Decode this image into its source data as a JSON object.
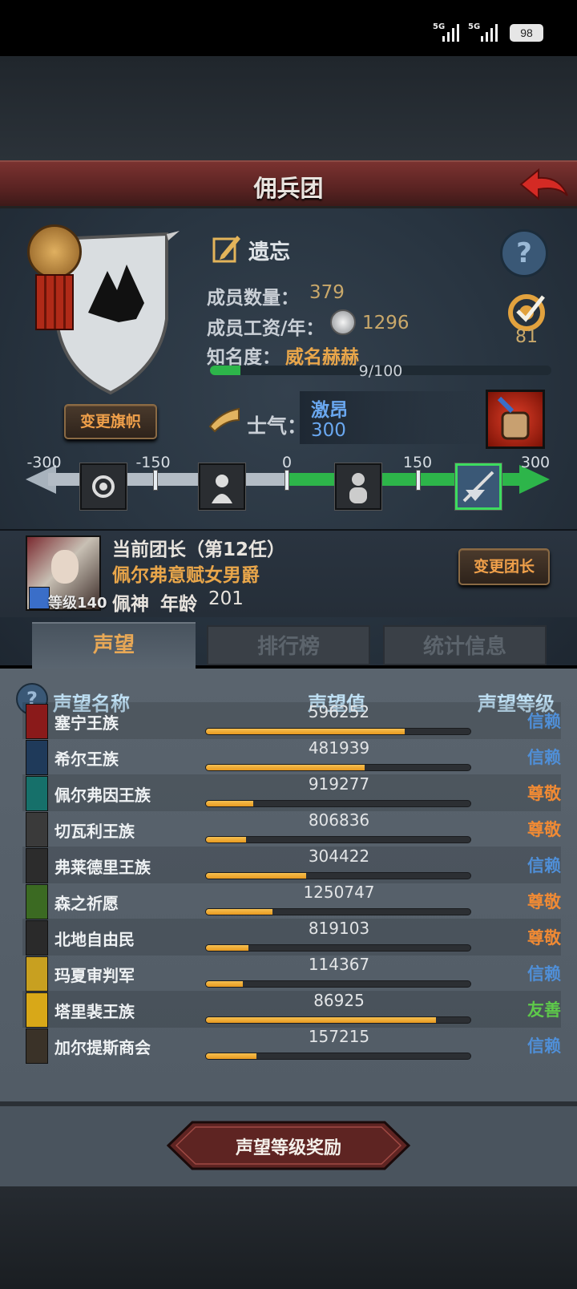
{
  "status_bar": {
    "signal1": "5G",
    "signal2": "5G",
    "battery": "98"
  },
  "header": {
    "title": "佣兵团"
  },
  "company": {
    "name": "遗忘",
    "members_label": "成员数量：",
    "members_value": "379",
    "salary_label": "成员工资/年：",
    "salary_value": "1296",
    "fame_label": "知名度：",
    "fame_title": "威名赫赫",
    "fame_progress_text": "9/100",
    "fame_progress": 0.09,
    "badge_value": "81",
    "change_flag_button": "变更旗帜"
  },
  "morale": {
    "label": "士气：",
    "state": "激昂",
    "value": "300",
    "ticks": [
      "-300",
      "-150",
      "0",
      "150",
      "300"
    ]
  },
  "leader": {
    "title": "当前团长（第12任）",
    "name": "佩尔弗意赋女男爵",
    "level_label": "等级140",
    "faith": "佩神",
    "age_label": "年龄",
    "age_value": "201",
    "change_leader_button": "变更团长"
  },
  "tabs": [
    {
      "label": "声望",
      "active": true
    },
    {
      "label": "排行榜",
      "active": false
    },
    {
      "label": "统计信息",
      "active": false
    }
  ],
  "table": {
    "col_name": "声望名称",
    "col_value": "声望值",
    "col_level": "声望等级",
    "rows": [
      {
        "name": "塞宁王族",
        "value": "596252",
        "level": "信赖",
        "progress": 0.75,
        "level_color": "#4f8fd8",
        "flag_color": "#8a1a1a"
      },
      {
        "name": "希尔王族",
        "value": "481939",
        "level": "信赖",
        "progress": 0.6,
        "level_color": "#4f8fd8",
        "flag_color": "#1f3a5a"
      },
      {
        "name": "佩尔弗因王族",
        "value": "919277",
        "level": "尊敬",
        "progress": 0.18,
        "level_color": "#f08a34",
        "flag_color": "#16706a"
      },
      {
        "name": "切瓦利王族",
        "value": "806836",
        "level": "尊敬",
        "progress": 0.15,
        "level_color": "#f08a34",
        "flag_color": "#3a3a3a"
      },
      {
        "name": "弗莱德里王族",
        "value": "304422",
        "level": "信赖",
        "progress": 0.38,
        "level_color": "#4f8fd8",
        "flag_color": "#2c2c2c"
      },
      {
        "name": "森之祈愿",
        "value": "1250747",
        "level": "尊敬",
        "progress": 0.25,
        "level_color": "#f08a34",
        "flag_color": "#3b6a22"
      },
      {
        "name": "北地自由民",
        "value": "819103",
        "level": "尊敬",
        "progress": 0.16,
        "level_color": "#f08a34",
        "flag_color": "#2a2a2a"
      },
      {
        "name": "玛夏审判军",
        "value": "114367",
        "level": "信赖",
        "progress": 0.14,
        "level_color": "#4f8fd8",
        "flag_color": "#c8a020"
      },
      {
        "name": "塔里裴王族",
        "value": "86925",
        "level": "友善",
        "progress": 0.87,
        "level_color": "#5ec94a",
        "flag_color": "#d8a818"
      },
      {
        "name": "加尔提斯商会",
        "value": "157215",
        "level": "信赖",
        "progress": 0.19,
        "level_color": "#4f8fd8",
        "flag_color": "#3a3228"
      }
    ]
  },
  "footer": {
    "reward_button": "声望等级奖励"
  }
}
